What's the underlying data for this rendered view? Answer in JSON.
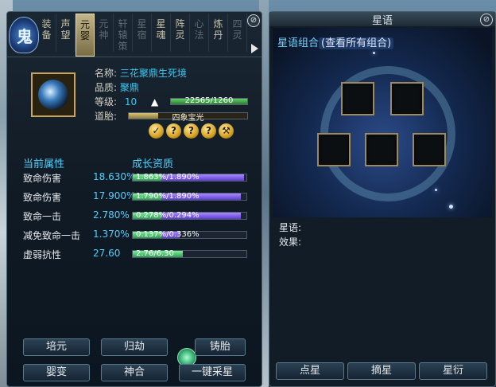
{
  "left_panel": {
    "avatar_glyph": "鬼",
    "tabs": [
      {
        "label": "装\n备",
        "state": "normal"
      },
      {
        "label": "声\n望",
        "state": "normal"
      },
      {
        "label": "元\n婴",
        "state": "active"
      },
      {
        "label": "元\n神",
        "state": "dim"
      },
      {
        "label": "轩\n辕\n策",
        "state": "dim"
      },
      {
        "label": "星\n宿",
        "state": "dim"
      },
      {
        "label": "星\n魂",
        "state": "normal"
      },
      {
        "label": "阵\n灵",
        "state": "normal"
      },
      {
        "label": "心\n法",
        "state": "dim"
      },
      {
        "label": "炼\n丹",
        "state": "normal"
      },
      {
        "label": "四\n灵",
        "state": "dim"
      }
    ],
    "close_label": "⊘",
    "item": {
      "name_label": "名称:",
      "name_value": "三花聚鼎生死境",
      "quality_label": "品质:",
      "quality_value": "聚鼎",
      "level_label": "等级:",
      "level_value": "10",
      "level_up_glyph": "▲",
      "exp_text": "22565/1260",
      "exp_fraction": 1.0,
      "dao_label": "道胎:",
      "dao_text": "四象宝光",
      "dao_fraction": 0.25,
      "dao_slots": [
        "✓",
        "?",
        "?",
        "?",
        "⚒"
      ]
    },
    "attr_header": "当前属性",
    "growth_header": "成长资质",
    "attributes": [
      {
        "name": "致命伤害",
        "value": "18.630%",
        "growth": "1.863%/1.890%",
        "green": 0.25,
        "purple": 0.98
      },
      {
        "name": "致命伤害",
        "value": "17.900%",
        "growth": "1.790%/1.890%",
        "green": 0.25,
        "purple": 0.95
      },
      {
        "name": "致命一击",
        "value": "2.780%",
        "growth": "0.278%/0.294%",
        "green": 0.25,
        "purple": 0.95
      },
      {
        "name": "减免致命一击",
        "value": "1.370%",
        "growth": "0.137%/0.336%",
        "green": 0.25,
        "purple": 0.41
      },
      {
        "name": "虚弱抗性",
        "value": "27.60",
        "growth": "2.76/6.30",
        "green": 0.44,
        "purple": 0.0
      }
    ],
    "buttons": {
      "peiyuan": "培元",
      "guijie": "归劫",
      "zhutai": "铸胎",
      "yingbian": "婴变",
      "shenhe": "神合",
      "yijian": "一键采星"
    },
    "colors": {
      "accent": "#4fd0ff",
      "gold": "#c9a45a"
    }
  },
  "right_panel": {
    "title": "星语",
    "close_label": "⊘",
    "combo_label": "星语组合",
    "combo_link": "(查看所有组合)",
    "star_slots": 5,
    "info_lines": [
      "星语:",
      "效果:"
    ],
    "buttons": [
      "点星",
      "摘星",
      "星衍"
    ]
  }
}
